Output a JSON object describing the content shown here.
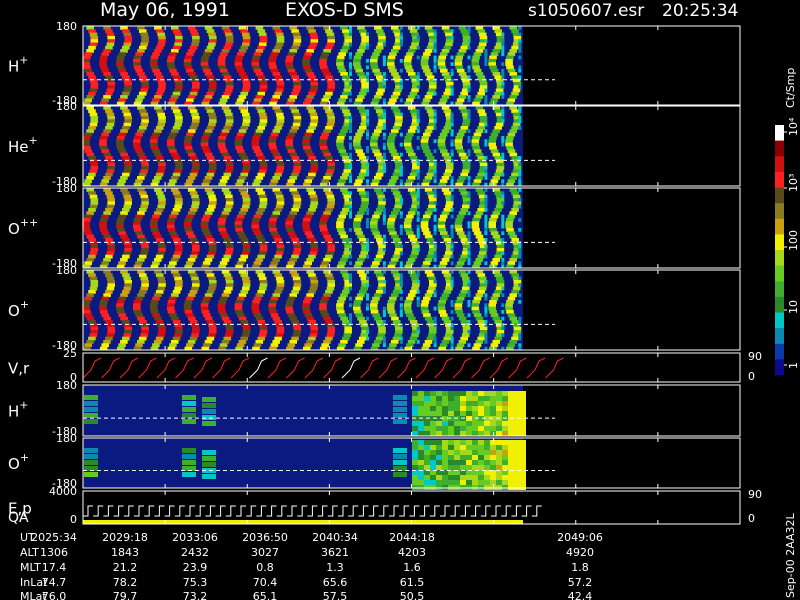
{
  "header": {
    "date": "May 06, 1991",
    "instrument": "EXOS-D SMS",
    "file": "s1050607.esr",
    "time": "20:25:34"
  },
  "colorbar": {
    "unit_label": "Ct/Smp",
    "ticks": [
      "1",
      "10",
      "100",
      "10³",
      "10⁴"
    ],
    "colors": [
      "#0a0a8a",
      "#0a3aaa",
      "#0a8ab0",
      "#00c8c8",
      "#2a8a2a",
      "#3fae2a",
      "#66cc22",
      "#a8d81a",
      "#f0f000",
      "#c8a010",
      "#8a7a20",
      "#5a4a1a",
      "#ff2020",
      "#d01010",
      "#8a0000",
      "#ffffff"
    ]
  },
  "panels": [
    {
      "key": "hplus_top",
      "label": "H",
      "sup": "+",
      "top_tick": "180",
      "bottom_tick": "-180"
    },
    {
      "key": "heplus",
      "label": "He",
      "sup": "+",
      "top_tick": "180",
      "bottom_tick": "-180"
    },
    {
      "key": "opp",
      "label": "O",
      "sup": "++",
      "top_tick": "180",
      "bottom_tick": "-180"
    },
    {
      "key": "oplus_top",
      "label": "O",
      "sup": "+",
      "top_tick": "180",
      "bottom_tick": "-180"
    },
    {
      "key": "vr",
      "label": "V,r",
      "sup": "",
      "top_tick": "25",
      "bottom_tick": "0",
      "right_top": "90",
      "right_bottom": "0"
    },
    {
      "key": "hplus_low",
      "label": "H",
      "sup": "+",
      "top_tick": "180",
      "bottom_tick": "-180"
    },
    {
      "key": "oplus_low",
      "label": "O",
      "sup": "+",
      "top_tick": "180",
      "bottom_tick": "-180"
    },
    {
      "key": "ep",
      "label": "E,p",
      "sup": "",
      "label2": "QA",
      "top_tick": "4000",
      "bottom_tick": "0",
      "right_top": "90",
      "right_bottom": "0"
    }
  ],
  "footer": {
    "row_labels": [
      "UT",
      "ALT",
      "MLT",
      "InLat",
      "MLat"
    ],
    "columns": [
      {
        "UT": "2025:34",
        "ALT": "1306",
        "MLT": "17.4",
        "InLat": "74.7",
        "MLat": "76.0"
      },
      {
        "UT": "2029:18",
        "ALT": "1843",
        "MLT": "21.2",
        "InLat": "78.2",
        "MLat": "79.7"
      },
      {
        "UT": "2033:06",
        "ALT": "2432",
        "MLT": "23.9",
        "InLat": "75.3",
        "MLat": "73.2"
      },
      {
        "UT": "2036:50",
        "ALT": "3027",
        "MLT": "0.8",
        "InLat": "70.4",
        "MLat": "65.1"
      },
      {
        "UT": "2040:34",
        "ALT": "3621",
        "MLT": "1.3",
        "InLat": "65.6",
        "MLat": "57.5"
      },
      {
        "UT": "2044:18",
        "ALT": "4203",
        "MLT": "1.6",
        "InLat": "61.5",
        "MLat": "50.5"
      },
      {
        "UT": "2049:06",
        "ALT": "4920",
        "MLT": "1.8",
        "InLat": "57.2",
        "MLat": "42.4"
      }
    ],
    "side_text": "Sep-00  2AA32L"
  },
  "chart_data": {
    "type": "heatmap",
    "x_time_range": [
      "20:25:34",
      "20:49:06"
    ],
    "data_ends_at_fraction": 0.67,
    "y_range_deg": [
      -180,
      180
    ],
    "vr_range": [
      0,
      25
    ],
    "ep_range": [
      0,
      4000
    ],
    "log_scale_colorbar": true,
    "stripe_count": 26
  }
}
